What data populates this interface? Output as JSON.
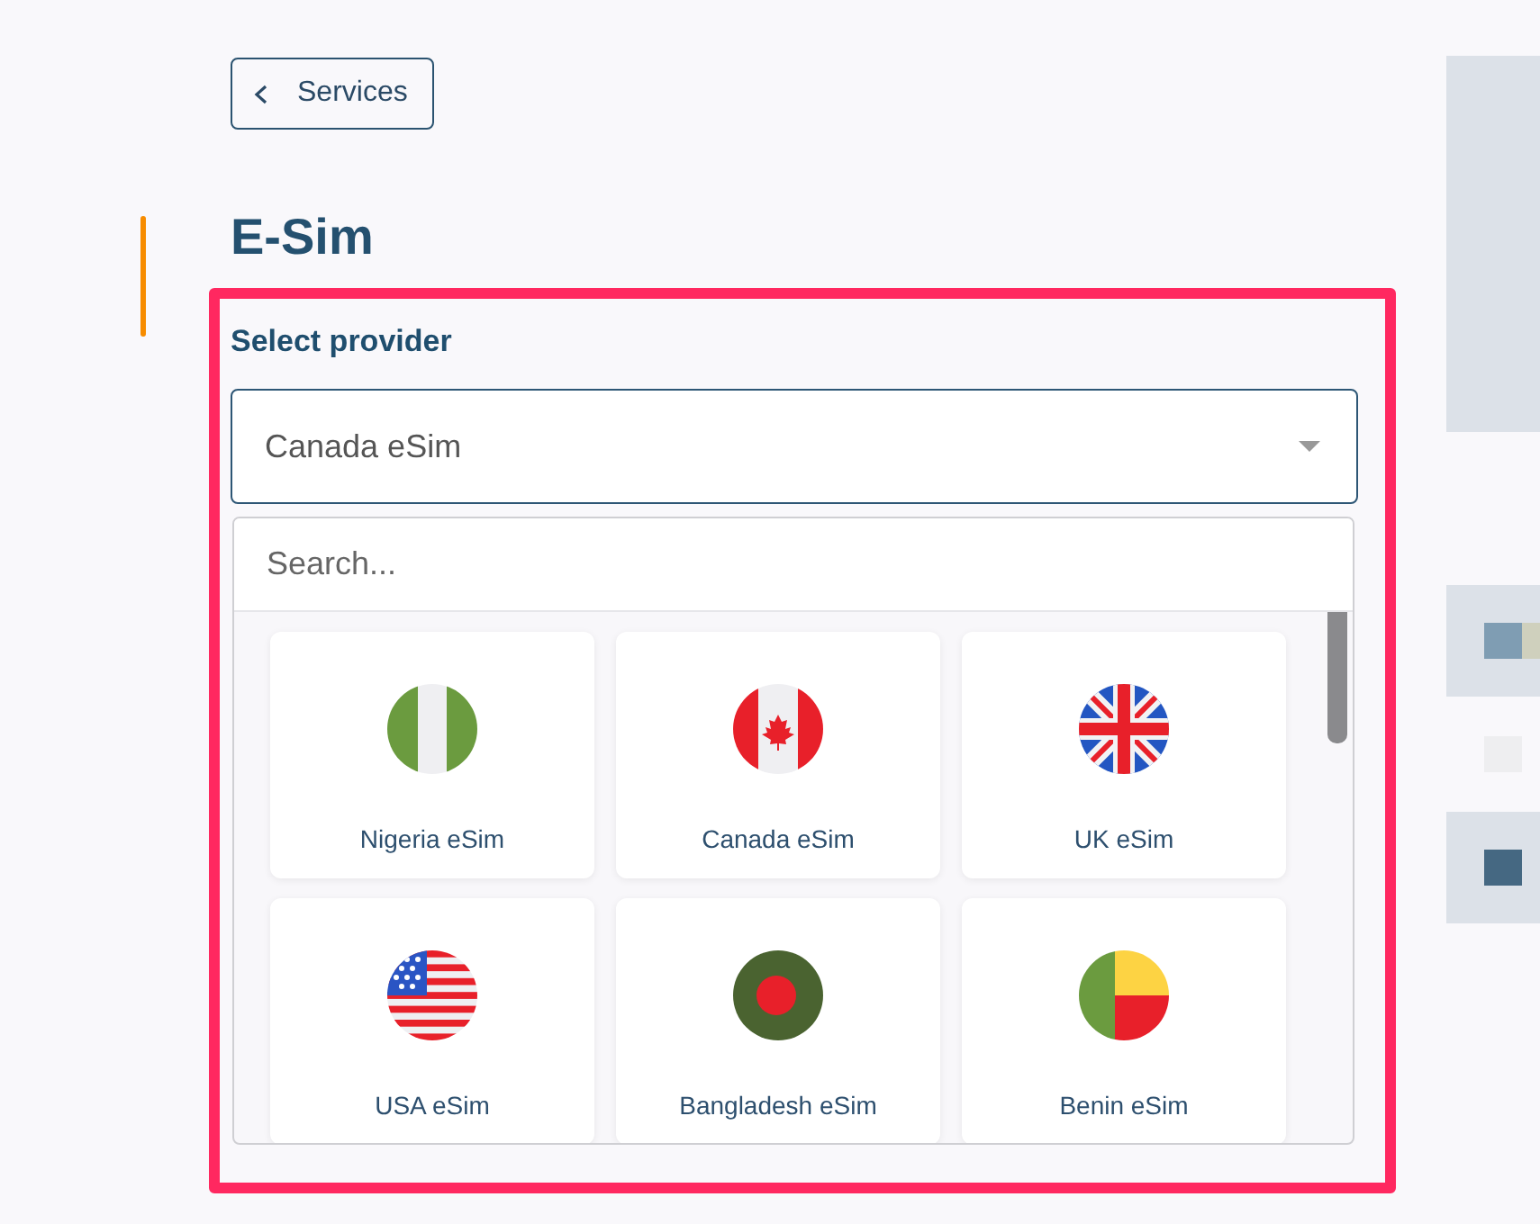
{
  "back_button": {
    "label": "Services"
  },
  "page_title": "E-Sim",
  "provider_select": {
    "highlighted": true,
    "label": "Select provider",
    "value": "Canada eSim",
    "expanded": true,
    "search": {
      "placeholder": "Search..."
    },
    "options": [
      {
        "label": "Nigeria eSim",
        "kind": "nigeria"
      },
      {
        "label": "Canada eSim",
        "kind": "canada"
      },
      {
        "label": "UK eSim",
        "kind": "uk"
      },
      {
        "label": "USA eSim",
        "kind": "usa"
      },
      {
        "label": "Bangladesh eSim",
        "kind": "bangladesh"
      },
      {
        "label": "Benin eSim",
        "kind": "benin"
      }
    ]
  }
}
